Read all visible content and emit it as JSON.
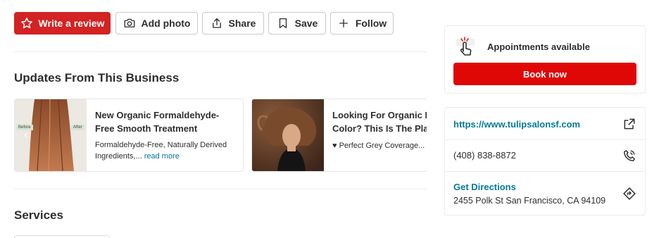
{
  "actions": {
    "write_review": "Write a review",
    "add_photo": "Add photo",
    "share": "Share",
    "save": "Save",
    "follow": "Follow"
  },
  "updates": {
    "title": "Updates From This Business",
    "cards": [
      {
        "title_line1": "New Organic Formaldehyde-",
        "title_line2": "Free Smooth Treatment",
        "desc_line1": "Formaldehyde-Free, Naturally Derived",
        "desc_line2": "Ingredients,... ",
        "read_more": "read more",
        "before_tag": "Before",
        "after_tag": "After"
      },
      {
        "title_line1": "Looking For Organic H",
        "title_line2": "Color? This Is The Plac",
        "desc_line1": "♥ Perfect Grey Coverage..."
      }
    ]
  },
  "services": {
    "title": "Services"
  },
  "booking": {
    "label": "Appointments available",
    "button": "Book now"
  },
  "info": {
    "website": "https://www.tulipsalonsf.com",
    "phone": "(408) 838-8872",
    "directions_label": "Get Directions",
    "address": "2455 Polk St San Francisco, CA 94109"
  },
  "colors": {
    "brand_red": "#d32323",
    "link_teal": "#027a97",
    "border": "#c8c9ca"
  }
}
